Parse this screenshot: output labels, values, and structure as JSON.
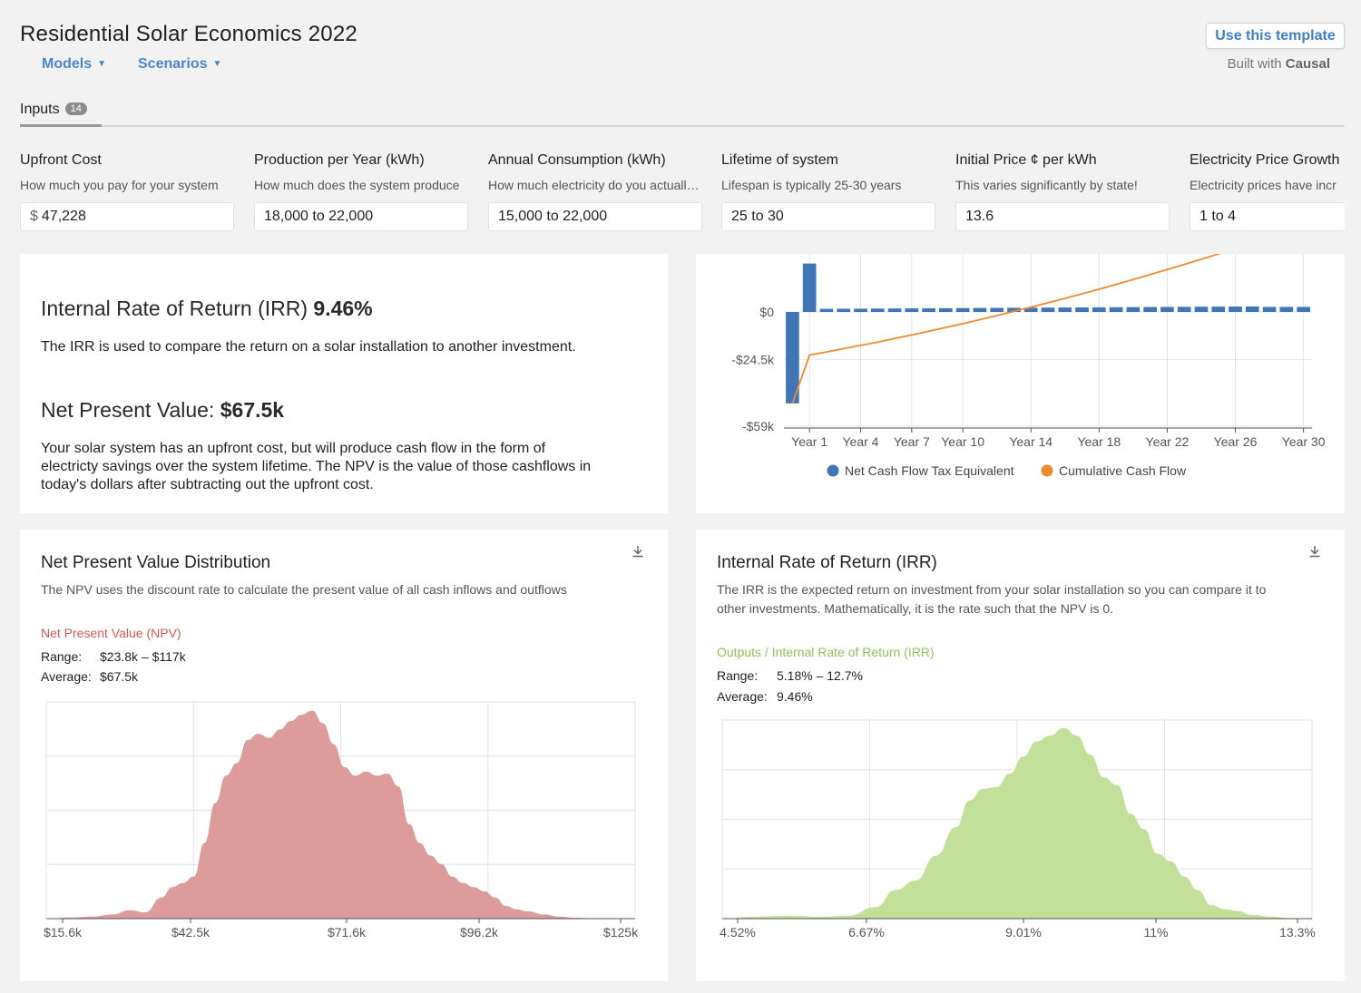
{
  "header": {
    "title": "Residential Solar Economics 2022",
    "models_label": "Models",
    "scenarios_label": "Scenarios",
    "use_template_label": "Use this template",
    "built_with_prefix": "Built with",
    "built_with_brand": "Causal"
  },
  "tabs": {
    "inputs_label": "Inputs",
    "inputs_count": "14"
  },
  "inputs": [
    {
      "label": "Upfront Cost",
      "description": "How much you pay for your system",
      "prefix": "$",
      "value": "47,228"
    },
    {
      "label": "Production per Year (kWh)",
      "description": "How much does the system produce",
      "prefix": "",
      "value": "18,000 to 22,000"
    },
    {
      "label": "Annual Consumption (kWh)",
      "description": "How much electricity do you actually use",
      "prefix": "",
      "value": "15,000 to 22,000"
    },
    {
      "label": "Lifetime of system",
      "description": "Lifespan is typically 25-30 years",
      "prefix": "",
      "value": "25 to 30"
    },
    {
      "label": "Initial Price ¢ per kWh",
      "description": "This varies significantly by state!",
      "prefix": "",
      "value": "13.6"
    },
    {
      "label": "Electricity Price Growth",
      "description": "Electricity prices have incr",
      "prefix": "",
      "value": "1 to 4"
    }
  ],
  "summary": {
    "irr_title": "Internal Rate of Return (IRR)",
    "irr_value": "9.46%",
    "irr_text": "The IRR is used to compare the return on a solar installation to another investment.",
    "npv_title": "Net Present Value:",
    "npv_value": "$67.5k",
    "npv_text_1": "Your solar system has an upfront cost, but will produce cash flow in the form of",
    "npv_text_2": "electricty savings over the system lifetime. The NPV is the value of those cashflows in",
    "npv_text_3": "today's dollars after subtracting out the upfront cost."
  },
  "npv_panel": {
    "title": "Net Present Value Distribution",
    "description": "The NPV uses the discount rate to calculate the present value of all cash inflows and outflows",
    "dist_name": "Net Present Value (NPV)",
    "range_label": "Range:",
    "range_value": "$23.8k – $117k",
    "avg_label": "Average:",
    "avg_value": "$67.5k"
  },
  "irr_panel": {
    "title": "Internal Rate of Return (IRR)",
    "description_1": "The IRR is the expected return on investment from your solar installation so you can compare it to",
    "description_2": "other investments. Mathematically, it is the rate such that the NPV is 0.",
    "dist_name": "Outputs / Internal Rate of Return (IRR)",
    "range_label": "Range:",
    "range_value": "5.18% – 12.7%",
    "avg_label": "Average:",
    "avg_value": "9.46%"
  },
  "colors": {
    "accent": "#4a86c9",
    "bar_blue": "#3f76b3",
    "line_orange": "#ee8a2f",
    "npv_fill": "#dc9c9c",
    "npv_label": "#d25a54",
    "irr_fill": "#c3e09a",
    "irr_label": "#8cc45b"
  },
  "chart_data": [
    {
      "type": "bar",
      "subtype": "bar-with-line",
      "x_ticks": [
        "Year 1",
        "Year 4",
        "Year 7",
        "Year 10",
        "Year 14",
        "Year 18",
        "Year 22",
        "Year 26",
        "Year 30"
      ],
      "y_ticks": [
        "$0",
        "-$24.5k",
        "-$59k"
      ],
      "ylim": [
        -59000,
        30000
      ],
      "legend": [
        "Net Cash Flow Tax Equivalent",
        "Cumulative Cash Flow"
      ],
      "legend_position": "bottom",
      "series": [
        {
          "name": "Net Cash Flow Tax Equivalent",
          "kind": "bar",
          "values": [
            -47228,
            25000,
            1600,
            1650,
            1700,
            1750,
            1800,
            1850,
            1900,
            1950,
            2000,
            2050,
            2100,
            2150,
            2200,
            2250,
            2300,
            2350,
            2400,
            2450,
            2500,
            2550,
            2600,
            2650,
            2700,
            2750,
            2800,
            2850,
            2600,
            2600,
            2600
          ]
        },
        {
          "name": "Cumulative Cash Flow",
          "kind": "line",
          "values": [
            -47228,
            -22228,
            -20628,
            -18978,
            -17278,
            -15528,
            -13728,
            -11878,
            -9978,
            -8028,
            -6028,
            -3978,
            -1878,
            272,
            2472,
            4722,
            7022,
            9372,
            11772,
            14222,
            16722,
            19272,
            21872,
            24522,
            27222,
            29972,
            32772,
            35622,
            38222,
            40822,
            43422
          ]
        }
      ]
    },
    {
      "type": "area",
      "name": "Net Present Value (NPV)",
      "x_ticks": [
        "$15.6k",
        "$42.5k",
        "$71.6k",
        "$96.2k",
        "$125k"
      ],
      "xlim": [
        15600,
        125000
      ],
      "x": [
        16000,
        20000,
        24000,
        28000,
        31000,
        34000,
        37000,
        39000,
        41000,
        43000,
        45000,
        47000,
        49000,
        51000,
        53000,
        55000,
        57000,
        59000,
        61000,
        63000,
        65000,
        67000,
        69000,
        71000,
        73000,
        75000,
        77000,
        79000,
        81000,
        83000,
        85000,
        87000,
        89000,
        91000,
        93000,
        95000,
        97000,
        99000,
        101000,
        103000,
        105000,
        108000,
        111000,
        114000,
        118000,
        125000
      ],
      "values": [
        0,
        0.005,
        0.01,
        0.02,
        0.04,
        0.03,
        0.1,
        0.15,
        0.17,
        0.2,
        0.36,
        0.55,
        0.68,
        0.74,
        0.85,
        0.88,
        0.86,
        0.9,
        0.94,
        0.97,
        0.99,
        0.93,
        0.83,
        0.72,
        0.68,
        0.7,
        0.68,
        0.69,
        0.63,
        0.45,
        0.36,
        0.3,
        0.26,
        0.2,
        0.17,
        0.15,
        0.13,
        0.1,
        0.06,
        0.045,
        0.035,
        0.02,
        0.01,
        0.004,
        0.001,
        0
      ]
    },
    {
      "type": "area",
      "name": "Outputs / Internal Rate of Return (IRR)",
      "x_ticks": [
        "4.52%",
        "6.67%",
        "9.01%",
        "11%",
        "13.3%"
      ],
      "xlim": [
        4.52,
        13.3
      ],
      "x": [
        4.52,
        5.0,
        5.5,
        6.0,
        6.4,
        6.8,
        7.1,
        7.4,
        7.7,
        8.0,
        8.2,
        8.4,
        8.6,
        8.8,
        9.0,
        9.2,
        9.4,
        9.6,
        9.8,
        10.0,
        10.2,
        10.4,
        10.6,
        10.8,
        11.0,
        11.2,
        11.4,
        11.6,
        11.8,
        12.0,
        12.2,
        12.4,
        12.7,
        13.0,
        13.3
      ],
      "values": [
        0,
        0.01,
        0.015,
        0.01,
        0.015,
        0.06,
        0.15,
        0.2,
        0.33,
        0.48,
        0.62,
        0.68,
        0.69,
        0.76,
        0.85,
        0.93,
        0.96,
        1.0,
        0.96,
        0.86,
        0.74,
        0.7,
        0.55,
        0.47,
        0.34,
        0.3,
        0.22,
        0.15,
        0.07,
        0.05,
        0.04,
        0.02,
        0.01,
        0.003,
        0
      ]
    }
  ]
}
